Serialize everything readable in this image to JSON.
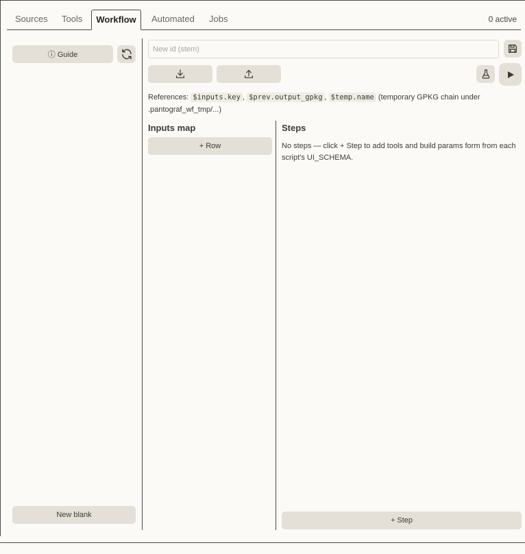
{
  "tabs": [
    {
      "label": "Sources",
      "active": false
    },
    {
      "label": "Tools",
      "active": false
    },
    {
      "label": "Workflow",
      "active": true
    },
    {
      "label": "Automated",
      "active": false
    },
    {
      "label": "Jobs",
      "active": false
    }
  ],
  "status": {
    "active_count": "0 active"
  },
  "left": {
    "guide_label": "ⓘ Guide",
    "new_blank_label": "New blank"
  },
  "editor": {
    "stem_placeholder": "New id (stem)",
    "references_prefix": "References:",
    "ref_inputs": "$inputs.key",
    "ref_prev": "$prev.output_gpkg",
    "ref_temp": "$temp.name",
    "references_suffix": "(temporary GPKG chain under .pantograf_wf_tmp/...)",
    "sep": ","
  },
  "inputs_map": {
    "title": "Inputs map",
    "add_row_label": "+ Row"
  },
  "steps": {
    "title": "Steps",
    "empty_text": "No steps — click + Step to add tools and build params form from each script's UI_SCHEMA.",
    "add_step_label": "+ Step"
  },
  "icons": {
    "refresh": "refresh-icon",
    "save": "save-icon",
    "download": "download-icon",
    "upload": "upload-icon",
    "test": "flask-icon",
    "run": "play-icon"
  },
  "colors": {
    "background": "#fbfaf6",
    "button": "#e4e0d8",
    "border": "#4a4844"
  }
}
